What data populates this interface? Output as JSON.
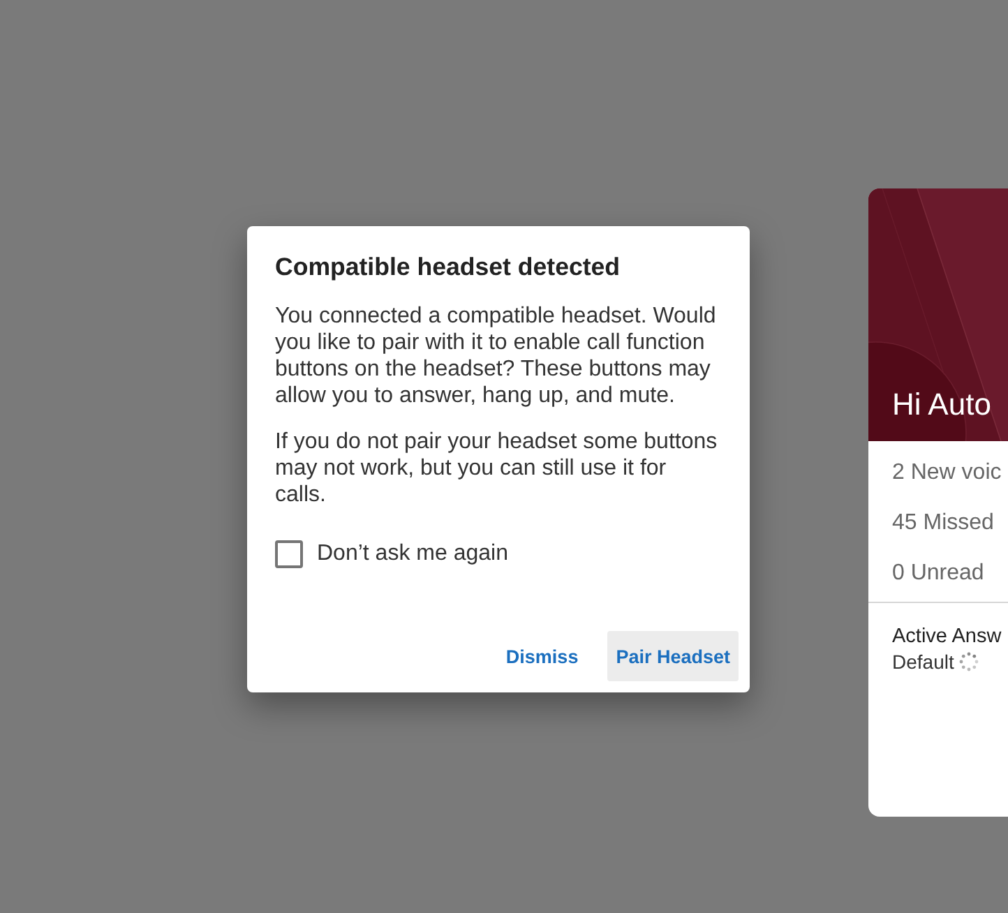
{
  "dialog": {
    "title": "Compatible headset detected",
    "paragraphs": [
      "You connected a compatible headset. Would you like to pair with it to enable call function buttons on the headset? These buttons may allow you to answer, hang up, and mute.",
      "If you do not pair your headset some buttons may not work, but you can still use it for calls."
    ],
    "checkbox": {
      "label": "Don’t ask me again",
      "checked": false
    },
    "buttons": [
      {
        "label": "Dismiss",
        "focused": false
      },
      {
        "label": "Pair Headset",
        "focused": true
      }
    ]
  },
  "card": {
    "greeting": "Hi Auto",
    "stats": [
      "2 New voic",
      "45 Missed",
      "0 Unread"
    ],
    "active_answer": {
      "title": "Active Answ",
      "value": "Default"
    }
  }
}
